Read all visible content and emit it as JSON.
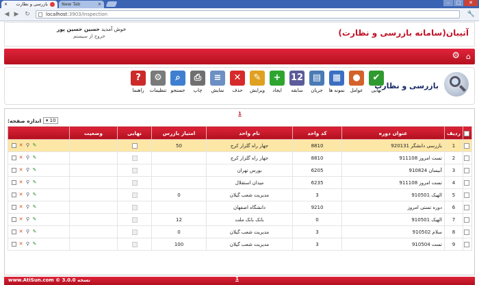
{
  "browser": {
    "active_tab": "بازرسی و نظارت",
    "inactive_tab": "New Tab",
    "url_host": "localhost",
    "url_path": ":3903/Inspection"
  },
  "header": {
    "brand": "آتیبان(سامانه بازرسی و نظارت)",
    "welcome_prefix": "خوش آمدید",
    "user_name": "حسین حسین پور",
    "logout": "خروج از سیستم"
  },
  "module": {
    "title": "بازرسی و نظارت",
    "tools": [
      {
        "name": "final",
        "label": "نهایی",
        "icon": "✔",
        "color": "#2f9a2f"
      },
      {
        "name": "factors",
        "label": "عوامل",
        "icon": "●",
        "color": "#d4612a"
      },
      {
        "name": "samples",
        "label": "نمونه ها",
        "icon": "▦",
        "color": "#3b6fc2"
      },
      {
        "name": "history",
        "label": "جریان",
        "icon": "▤",
        "color": "#4a7bb5"
      },
      {
        "name": "record",
        "label": "سابقه",
        "icon": "12",
        "color": "#5c5c9a"
      },
      {
        "name": "create",
        "label": "ایجاد",
        "icon": "+",
        "color": "#2ea52e"
      },
      {
        "name": "edit",
        "label": "ویرایش",
        "icon": "✎",
        "color": "#e0a020"
      },
      {
        "name": "delete",
        "label": "حذف",
        "icon": "✕",
        "color": "#d62a2a"
      },
      {
        "name": "view",
        "label": "نمایش",
        "icon": "≡",
        "color": "#6c8fc4"
      },
      {
        "name": "print",
        "label": "چاپ",
        "icon": "⎙",
        "color": "#707070"
      },
      {
        "name": "search",
        "label": "جستجو",
        "icon": "⌕",
        "color": "#3f7fcf"
      },
      {
        "name": "settings",
        "label": "تنظیمات",
        "icon": "⚙",
        "color": "#7a7a7a"
      },
      {
        "name": "help",
        "label": "راهنما",
        "icon": "?",
        "color": "#cc2a2a"
      }
    ]
  },
  "grid": {
    "pager": "1",
    "page_size_label": "اندازه صفحه:",
    "page_size": "10",
    "headers": {
      "row": "ردیف",
      "title": "عنوان دوره",
      "unit_code": "کد واحد",
      "unit_name": "نام واحد",
      "inspector_score": "امتیاز بازرس",
      "final": "نهایی",
      "status": "وضعیت"
    },
    "rows": [
      {
        "n": "1",
        "title": "بازرسی دانشگر 920131",
        "code": "8810",
        "unit": "جهار راه گلزار کرج",
        "score": "50",
        "final": "unchecked"
      },
      {
        "n": "2",
        "title": "تست امروز 911108",
        "code": "8810",
        "unit": "جهار راه گلزار کرج",
        "score": "",
        "final": "disabled"
      },
      {
        "n": "3",
        "title": "آنیسان 910824",
        "code": "6205",
        "unit": "بورس تهران",
        "score": "",
        "final": "disabled"
      },
      {
        "n": "4",
        "title": "تست امروز 911108",
        "code": "6235",
        "unit": "میدان استقلال",
        "score": "",
        "final": "disabled"
      },
      {
        "n": "5",
        "title": "الهیک 910501",
        "code": "3",
        "unit": "مدیریت شعب گیلان",
        "score": "0",
        "final": "disabled"
      },
      {
        "n": "6",
        "title": "دوره تستی امروز",
        "code": "9210",
        "unit": "دانشگاه اصفهان",
        "score": "",
        "final": "disabled"
      },
      {
        "n": "7",
        "title": "الهیک 910501",
        "code": "0",
        "unit": "بانک بانک ملت",
        "score": "12",
        "final": "disabled"
      },
      {
        "n": "8",
        "title": "سلام 910502",
        "code": "3",
        "unit": "مدیریت شعب گیلان",
        "score": "0",
        "final": "disabled"
      },
      {
        "n": "9",
        "title": "تست 910504",
        "code": "3",
        "unit": "مدیریت شعب گیلان",
        "score": "100",
        "final": "disabled"
      }
    ]
  },
  "footer": {
    "pager": "1",
    "version": "نسخه 3.0.0 © www.AtiSun.com"
  }
}
